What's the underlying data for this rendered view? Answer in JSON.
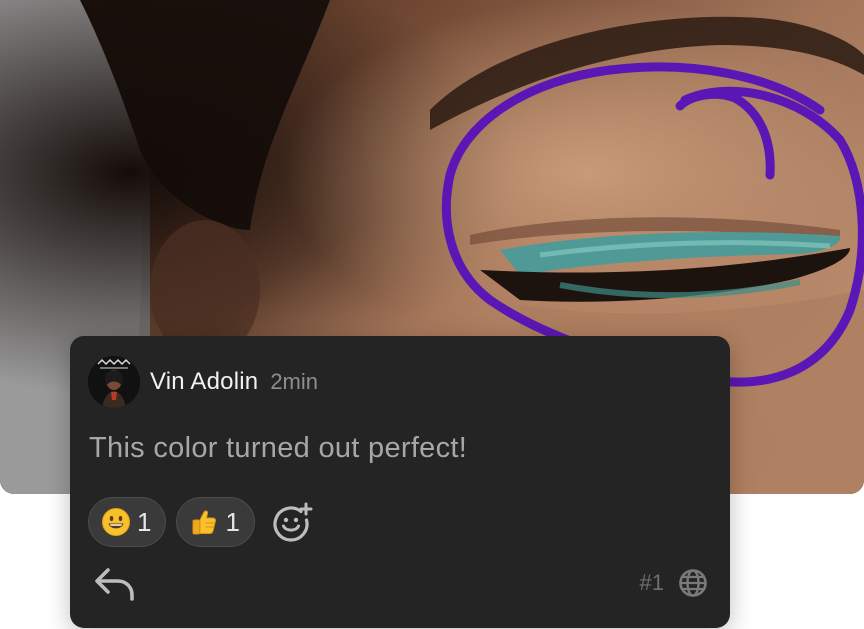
{
  "comment": {
    "author": "Vin Adolin",
    "time": "2min",
    "text": "This color turned out perfect!",
    "number": "#1"
  },
  "reactions": [
    {
      "emoji": "grinning-face",
      "count": "1"
    },
    {
      "emoji": "thumbs-up",
      "count": "1"
    }
  ],
  "icons": {
    "add_reaction": "add-reaction-icon",
    "reply": "reply-icon",
    "visibility": "globe-icon"
  },
  "colors": {
    "annotation_stroke": "#5b17b5",
    "card_bg": "#242424",
    "chip_bg": "#3a3a3a"
  }
}
